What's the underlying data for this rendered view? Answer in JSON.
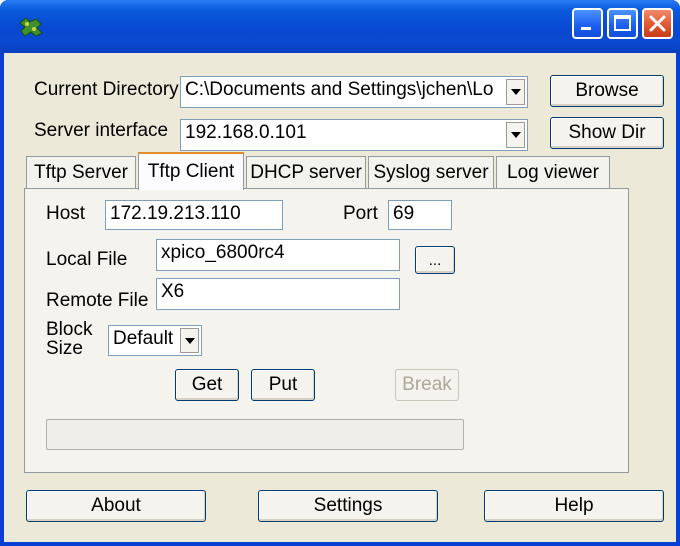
{
  "titlebar": {
    "icons": {
      "app": "app-icon",
      "minimize": "minimize-icon",
      "maximize": "maximize-icon",
      "close": "close-icon"
    }
  },
  "top": {
    "current_directory_label": "Current Directory",
    "current_directory_value": "C:\\Documents and Settings\\jchen\\Lo",
    "browse_label": "Browse",
    "server_interface_label": "Server interface",
    "server_interface_value": "192.168.0.101",
    "show_dir_label": "Show Dir"
  },
  "tabs": [
    {
      "label": "Tftp Server"
    },
    {
      "label": "Tftp Client"
    },
    {
      "label": "DHCP server"
    },
    {
      "label": "Syslog server"
    },
    {
      "label": "Log viewer"
    }
  ],
  "client": {
    "host_label": "Host",
    "host_value": "172.19.213.110",
    "port_label": "Port",
    "port_value": "69",
    "local_file_label": "Local File",
    "local_file_value": "xpico_6800rc4",
    "browse_local_label": "...",
    "remote_file_label": "Remote File",
    "remote_file_value": "X6",
    "block_size_label_1": "Block",
    "block_size_label_2": "Size",
    "block_size_value": "Default",
    "get_label": "Get",
    "put_label": "Put",
    "break_label": "Break",
    "progress": 0
  },
  "bottom": {
    "about_label": "About",
    "settings_label": "Settings",
    "help_label": "Help"
  },
  "colors": {
    "titlebar": "#0a5bdc",
    "close_button": "#e2572f",
    "dialog_bg": "#ece9d8",
    "active_tab_accent": "#e68b2c"
  }
}
